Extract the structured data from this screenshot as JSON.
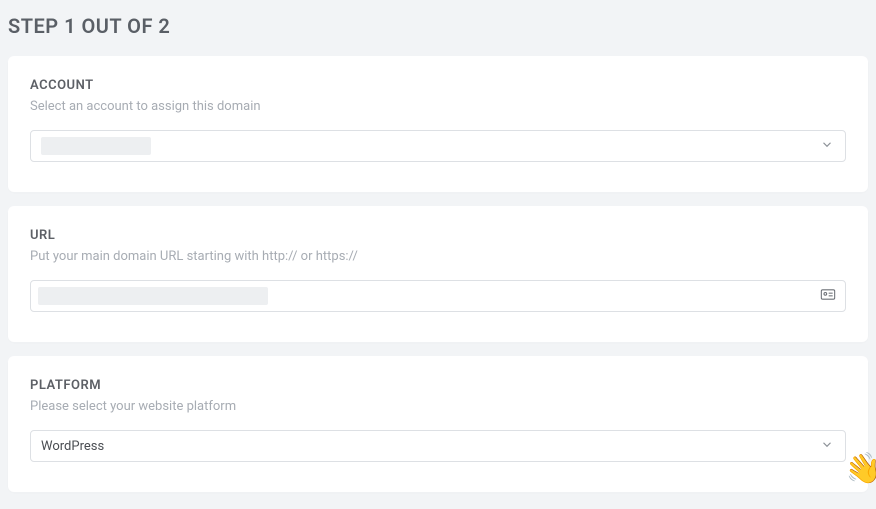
{
  "header": {
    "step_title": "STEP 1 OUT OF 2"
  },
  "account": {
    "label": "ACCOUNT",
    "hint": "Select an account to assign this domain",
    "selected": ""
  },
  "url": {
    "label": "URL",
    "hint": "Put your main domain URL starting with http:// or https://",
    "value": ""
  },
  "platform": {
    "label": "PLATFORM",
    "hint": "Please select your website platform",
    "selected": "WordPress"
  },
  "widget": {
    "wave_emoji": "👋"
  }
}
